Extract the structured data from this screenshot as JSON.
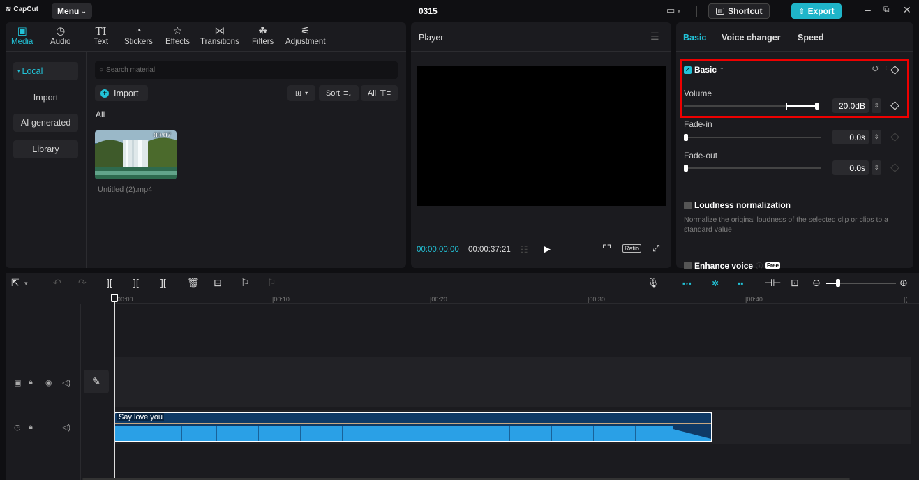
{
  "app": {
    "logo": "CapCut",
    "menu_label": "Menu",
    "project_title": "0315",
    "shortcut_label": "Shortcut",
    "export_label": "Export"
  },
  "media_panel": {
    "tabs": [
      {
        "label": "Media",
        "icon": "media-icon"
      },
      {
        "label": "Audio",
        "icon": "audio-icon"
      },
      {
        "label": "Text",
        "icon": "text-icon"
      },
      {
        "label": "Stickers",
        "icon": "stickers-icon"
      },
      {
        "label": "Effects",
        "icon": "effects-icon"
      },
      {
        "label": "Transitions",
        "icon": "transitions-icon"
      },
      {
        "label": "Filters",
        "icon": "filters-icon"
      },
      {
        "label": "Adjustment",
        "icon": "adjustment-icon"
      }
    ],
    "sidebar": [
      "Local",
      "Import",
      "AI generated",
      "Library"
    ],
    "search_placeholder": "Search material",
    "import_label": "Import",
    "sort_label": "Sort",
    "all_filter_label": "All",
    "section_label": "All",
    "clip": {
      "duration": "00:07",
      "name": "Untitled (2).mp4"
    }
  },
  "player": {
    "title": "Player",
    "current_time": "00:00:00:00",
    "total_time": "00:00:37:21",
    "ratio_label": "Ratio"
  },
  "properties": {
    "tabs": [
      "Basic",
      "Voice changer",
      "Speed"
    ],
    "basic_section": "Basic",
    "volume_label": "Volume",
    "volume_value": "20.0dB",
    "fade_in_label": "Fade-in",
    "fade_in_value": "0.0s",
    "fade_out_label": "Fade-out",
    "fade_out_value": "0.0s",
    "loudness_label": "Loudness normalization",
    "loudness_desc": "Normalize the original loudness of the selected clip or clips to a standard value",
    "enhance_label": "Enhance voice",
    "free_badge": "Free"
  },
  "timeline": {
    "ruler": [
      "00:00",
      "|00:10",
      "|00:20",
      "|00:30",
      "|00:40",
      "|("
    ],
    "audio_clip_label": "Say love you"
  }
}
